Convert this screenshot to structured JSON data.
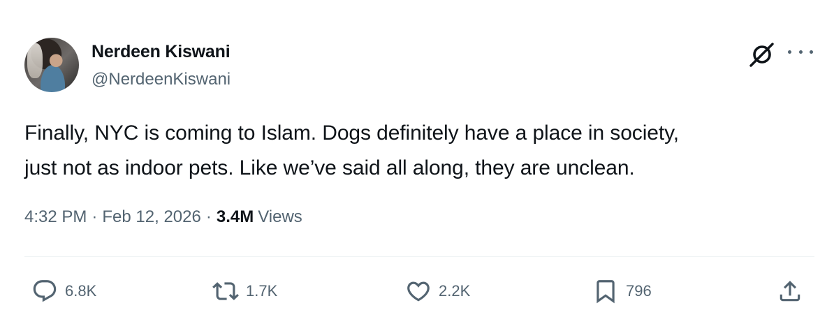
{
  "author": {
    "name": "Nerdeen Kiswani",
    "handle": "@NerdeenKiswani"
  },
  "tweet": {
    "text_lines": [
      "Finally, NYC is coming to Islam. Dogs definitely have a place in society,",
      "just not as indoor pets. Like we’ve said all along, they are unclean."
    ],
    "time": "4:32 PM",
    "date": "Feb 12, 2026",
    "separator": "·",
    "views_count": "3.4M",
    "views_label": "Views"
  },
  "actions": {
    "replies": "6.8K",
    "reposts": "1.7K",
    "likes": "2.2K",
    "bookmarks": "796"
  },
  "icons": {
    "grok": "grok-icon",
    "more": "more-dots-icon",
    "reply": "reply-bubble-icon",
    "repost": "repost-icon",
    "like": "heart-icon",
    "bookmark": "bookmark-icon",
    "share": "share-upload-icon"
  },
  "colors": {
    "text": "#0f1419",
    "secondary": "#536471",
    "divider": "#eff3f4"
  }
}
